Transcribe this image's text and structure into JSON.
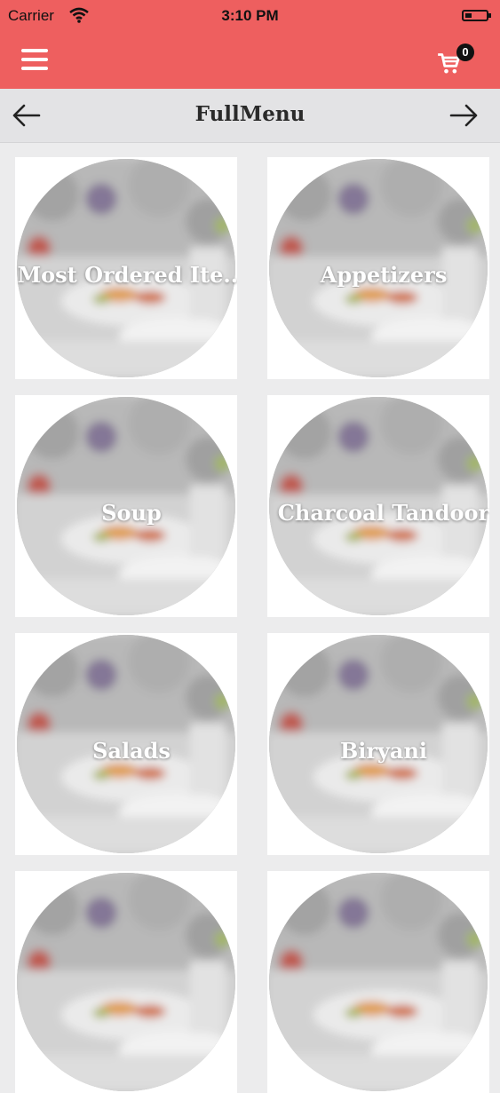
{
  "status_bar": {
    "carrier": "Carrier",
    "time": "3:10 PM"
  },
  "header": {
    "menu_icon": "hamburger-menu-icon",
    "cart_icon": "shopping-cart-icon",
    "cart_count": "0",
    "background_color": "#ee5f5f"
  },
  "subheader": {
    "title": "FullMenu",
    "back_icon": "arrow-left-icon",
    "forward_icon": "arrow-right-icon"
  },
  "categories": [
    {
      "label": "Most Ordered Ite..."
    },
    {
      "label": "Appetizers"
    },
    {
      "label": "Soup"
    },
    {
      "label": "Charcoal Tandoor"
    },
    {
      "label": "Salads"
    },
    {
      "label": "Biryani"
    },
    {
      "label": ""
    },
    {
      "label": ""
    }
  ]
}
